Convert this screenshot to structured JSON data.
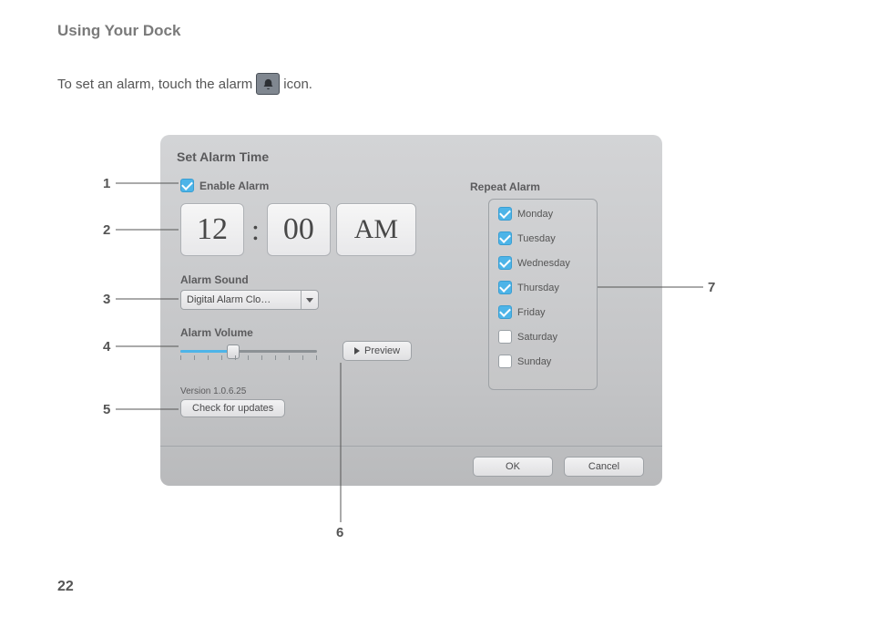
{
  "page": {
    "title": "Using Your Dock",
    "intro_before": "To set an alarm, touch the alarm",
    "intro_after": "icon.",
    "page_number": "22"
  },
  "dialog": {
    "title": "Set Alarm Time",
    "enable_label": "Enable Alarm",
    "time": {
      "hour": "12",
      "minute": "00",
      "ampm": "AM"
    },
    "alarm_sound_label": "Alarm Sound",
    "alarm_sound_value": "Digital Alarm Clo…",
    "alarm_volume_label": "Alarm Volume",
    "preview_label": "Preview",
    "version_text": "Version 1.0.6.25",
    "updates_label": "Check for updates",
    "repeat_label": "Repeat Alarm",
    "repeat_days": [
      {
        "label": "Monday",
        "checked": true
      },
      {
        "label": "Tuesday",
        "checked": true
      },
      {
        "label": "Wednesday",
        "checked": true
      },
      {
        "label": "Thursday",
        "checked": true
      },
      {
        "label": "Friday",
        "checked": true
      },
      {
        "label": "Saturday",
        "checked": false
      },
      {
        "label": "Sunday",
        "checked": false
      }
    ],
    "ok_label": "OK",
    "cancel_label": "Cancel"
  },
  "callouts": {
    "n1": "1",
    "n2": "2",
    "n3": "3",
    "n4": "4",
    "n5": "5",
    "n6": "6",
    "n7": "7"
  }
}
